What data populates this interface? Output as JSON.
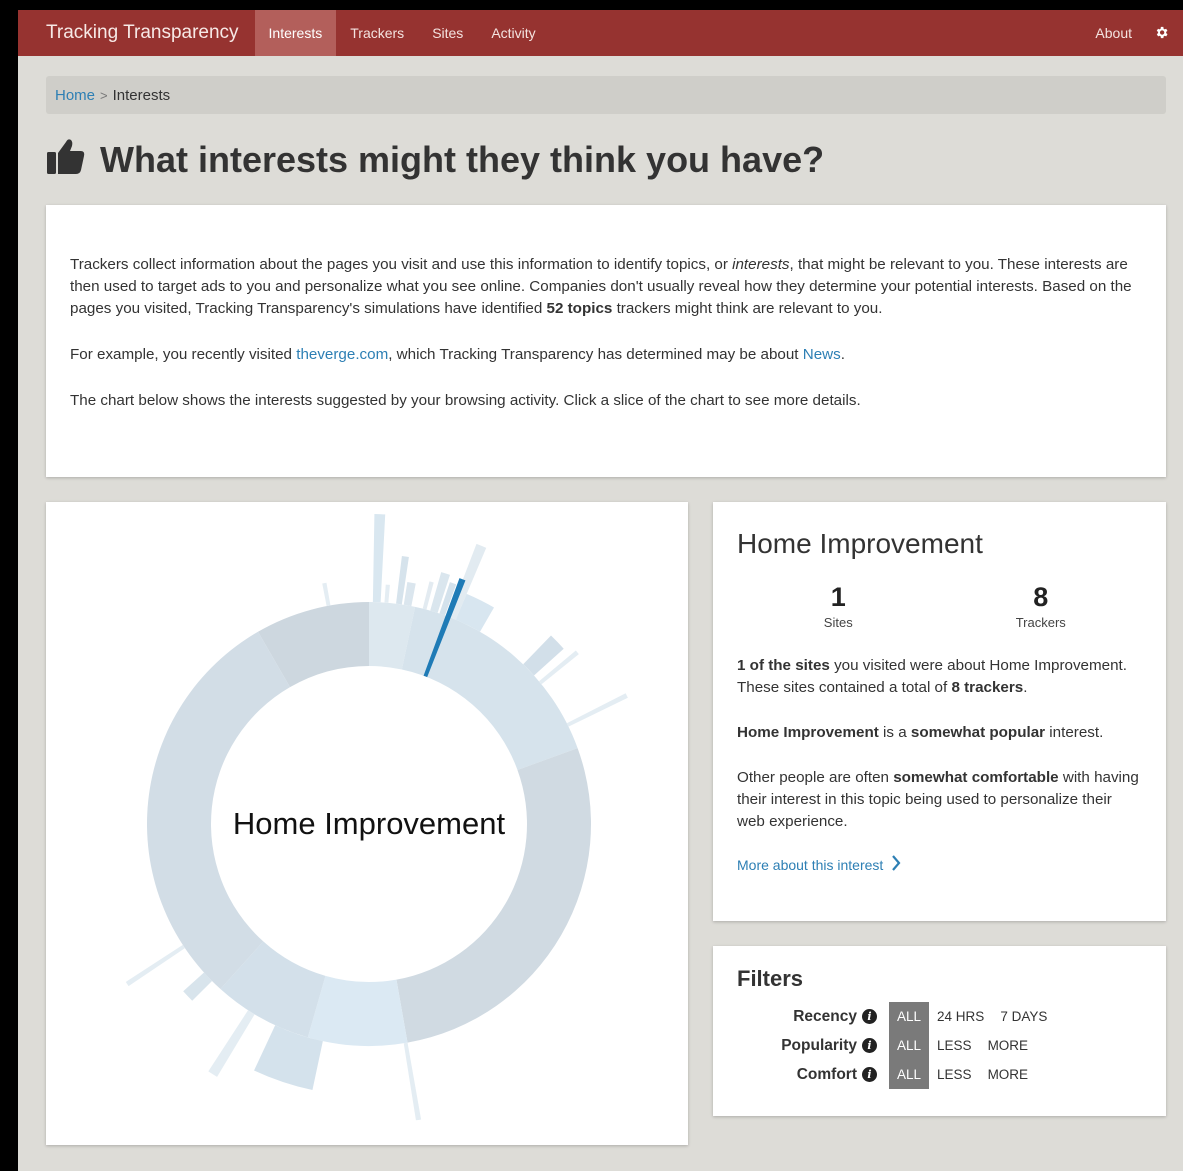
{
  "nav": {
    "brand": "Tracking Transparency",
    "items": [
      "Interests",
      "Trackers",
      "Sites",
      "Activity"
    ],
    "active": "Interests",
    "about": "About",
    "settings_icon": "gear-icon"
  },
  "breadcrumb": {
    "home": "Home",
    "separator": ">",
    "current": "Interests"
  },
  "page": {
    "title": "What interests might they think you have?",
    "title_icon": "thumbs-up-icon"
  },
  "intro": {
    "p1_a": "Trackers collect information about the pages you visit and use this information to identify topics, or ",
    "p1_em": "interests",
    "p1_b": ", that might be relevant to you. These interests are then used to target ads to you and personalize what you see online. Companies don't usually reveal how they determine your potential interests. Based on the pages you visited, Tracking Transparency's simulations have identified ",
    "p1_strong": "52 topics",
    "p1_c": " trackers might think are relevant to you.",
    "p2_a": "For example, you recently visited ",
    "p2_link1": "theverge.com",
    "p2_b": ", which Tracking Transparency has determined may be about ",
    "p2_link2": "News",
    "p2_c": ".",
    "p3": "The chart below shows the interests suggested by your browsing activity. Click a slice of the chart to see more details."
  },
  "chart": {
    "center_label": "Home Improvement",
    "selected": "Home Improvement",
    "selected_color": "#1f7bb6",
    "base_color": "#cfdbe3"
  },
  "detail": {
    "title": "Home Improvement",
    "sites_count": "1",
    "sites_label": "Sites",
    "trackers_count": "8",
    "trackers_label": "Trackers",
    "p1_strong1": "1 of the sites",
    "p1_a": " you visited were about Home Improvement. These sites contained a total of ",
    "p1_strong2": "8 trackers",
    "p1_b": ".",
    "p2_strong1": "Home Improvement",
    "p2_a": " is a ",
    "p2_strong2": "somewhat popular",
    "p2_b": " interest.",
    "p3_a": "Other people are often ",
    "p3_strong": "somewhat comfortable",
    "p3_b": " with having their interest in this topic being used to personalize their web experience.",
    "more_link": "More about this interest",
    "more_icon": "chevron-right-icon"
  },
  "filters": {
    "title": "Filters",
    "rows": [
      {
        "label": "Recency",
        "options": [
          "ALL",
          "24 HRS",
          "7 DAYS"
        ],
        "selected": "ALL"
      },
      {
        "label": "Popularity",
        "options": [
          "ALL",
          "LESS",
          "MORE"
        ],
        "selected": "ALL"
      },
      {
        "label": "Comfort",
        "options": [
          "ALL",
          "LESS",
          "MORE"
        ],
        "selected": "ALL"
      }
    ]
  }
}
